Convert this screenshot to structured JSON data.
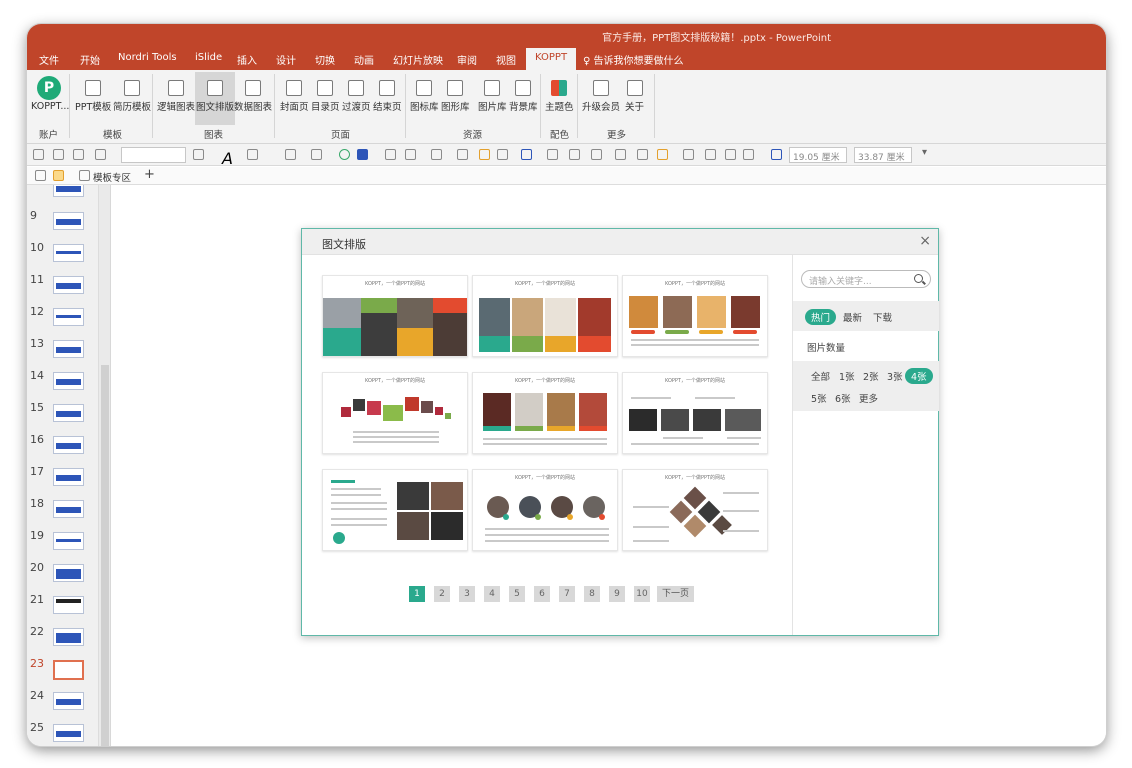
{
  "window": {
    "title": "官方手册，PPT图文排版秘籍！.pptx  -  PowerPoint"
  },
  "tabs": [
    "文件",
    "开始",
    "Nordri Tools",
    "iSlide",
    "插入",
    "设计",
    "切换",
    "动画",
    "幻灯片放映",
    "审阅",
    "视图",
    "KOPPT"
  ],
  "tell_me": "告诉我你想要做什么",
  "ribbon": {
    "account_btn": "KOPPT...",
    "buttons": [
      "PPT模板",
      "简历模板",
      "逻辑图表",
      "图文排版",
      "数据图表",
      "封面页",
      "目录页",
      "过渡页",
      "结束页",
      "图标库",
      "图形库",
      "图片库",
      "背景库",
      "主题色",
      "升级会员",
      "关于"
    ],
    "groups": [
      "账户",
      "模板",
      "图表",
      "页面",
      "资源",
      "配色",
      "更多"
    ]
  },
  "format_bar": {
    "width": "19.05 厘米",
    "height": "33.87 厘米"
  },
  "tabstrip": {
    "label": "模板专区"
  },
  "slides": {
    "numbers": [
      "9",
      "10",
      "11",
      "12",
      "13",
      "14",
      "15",
      "16",
      "17",
      "18",
      "19",
      "20",
      "21",
      "22",
      "23",
      "24",
      "25"
    ],
    "current": "23"
  },
  "dialog": {
    "title": "图文排版",
    "close": "×",
    "search_placeholder": "请输入关键字...",
    "sort": [
      "热门",
      "最新",
      "下载"
    ],
    "pic_count_label": "图片数量",
    "counts": [
      "全部",
      "1张",
      "2张",
      "3张",
      "4张",
      "5张",
      "6张",
      "更多"
    ],
    "card_title": "KOPPT，一个做PPT的网站",
    "pages": [
      "1",
      "2",
      "3",
      "4",
      "5",
      "6",
      "7",
      "8",
      "9",
      "10"
    ],
    "next": "下一页"
  },
  "colors": {
    "accent": "#c0452a",
    "teal": "#2aa98d"
  }
}
